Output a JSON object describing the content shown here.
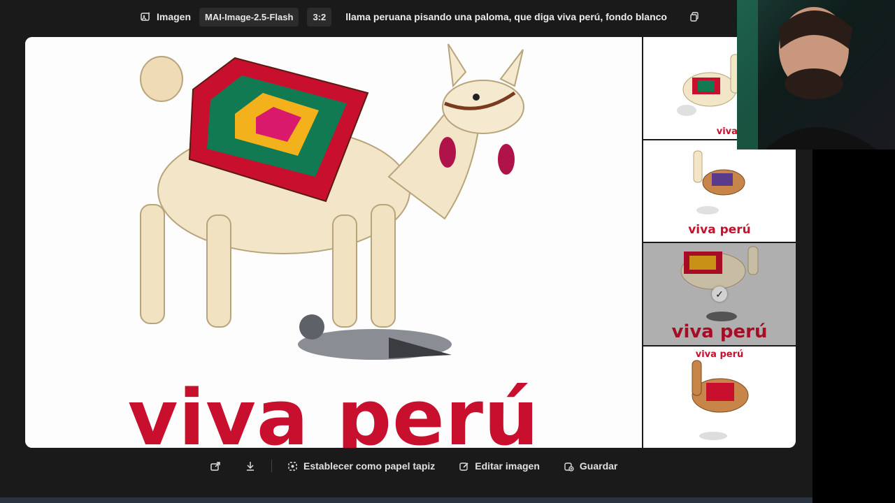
{
  "toolbar": {
    "mode_label": "Imagen",
    "model_label": "MAI-Image-2.5-Flash",
    "ratio_label": "3:2",
    "prompt_text": "llama peruana pisando una paloma, que diga viva perú, fondo blanco"
  },
  "main_image": {
    "caption": "viva perú"
  },
  "thumbnails": [
    {
      "caption": "viva perú",
      "selected": false
    },
    {
      "caption": "viva perú",
      "selected": false
    },
    {
      "caption": "viva perú",
      "selected": true
    },
    {
      "caption": "viva perú",
      "selected": false
    }
  ],
  "actions": {
    "set_wallpaper": "Establecer como papel tapiz",
    "edit_image": "Editar imagen",
    "save": "Guardar"
  },
  "colors": {
    "brand_red": "#c8102e",
    "background": "#1a1a1a"
  }
}
